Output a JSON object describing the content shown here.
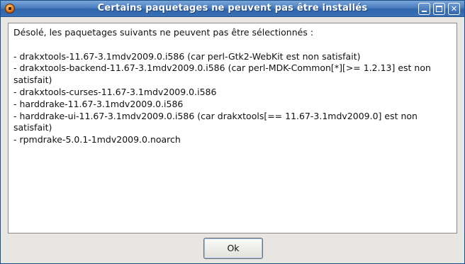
{
  "window": {
    "title": "Certains paquetages ne peuvent pas être installés"
  },
  "message": {
    "intro": "Désolé, les paquetages suivants ne peuvent pas être sélectionnés :",
    "lines": [
      "- drakxtools-11.67-3.1mdv2009.0.i586 (car perl-Gtk2-WebKit est non satisfait)",
      "- drakxtools-backend-11.67-3.1mdv2009.0.i586 (car perl-MDK-Common[*][>= 1.2.13] est non satisfait)",
      "- drakxtools-curses-11.67-3.1mdv2009.0.i586",
      "- harddrake-11.67-3.1mdv2009.0.i586",
      "- harddrake-ui-11.67-3.1mdv2009.0.i586 (car drakxtools[== 11.67-3.1mdv2009.0] est non satisfait)",
      "- rpmdrake-5.0.1-1mdv2009.0.noarch"
    ]
  },
  "buttons": {
    "ok_label": "Ok"
  },
  "icons": {
    "app": "app-icon",
    "minimize": "minimize-icon",
    "maximize": "maximize-icon",
    "close": "close-icon"
  }
}
